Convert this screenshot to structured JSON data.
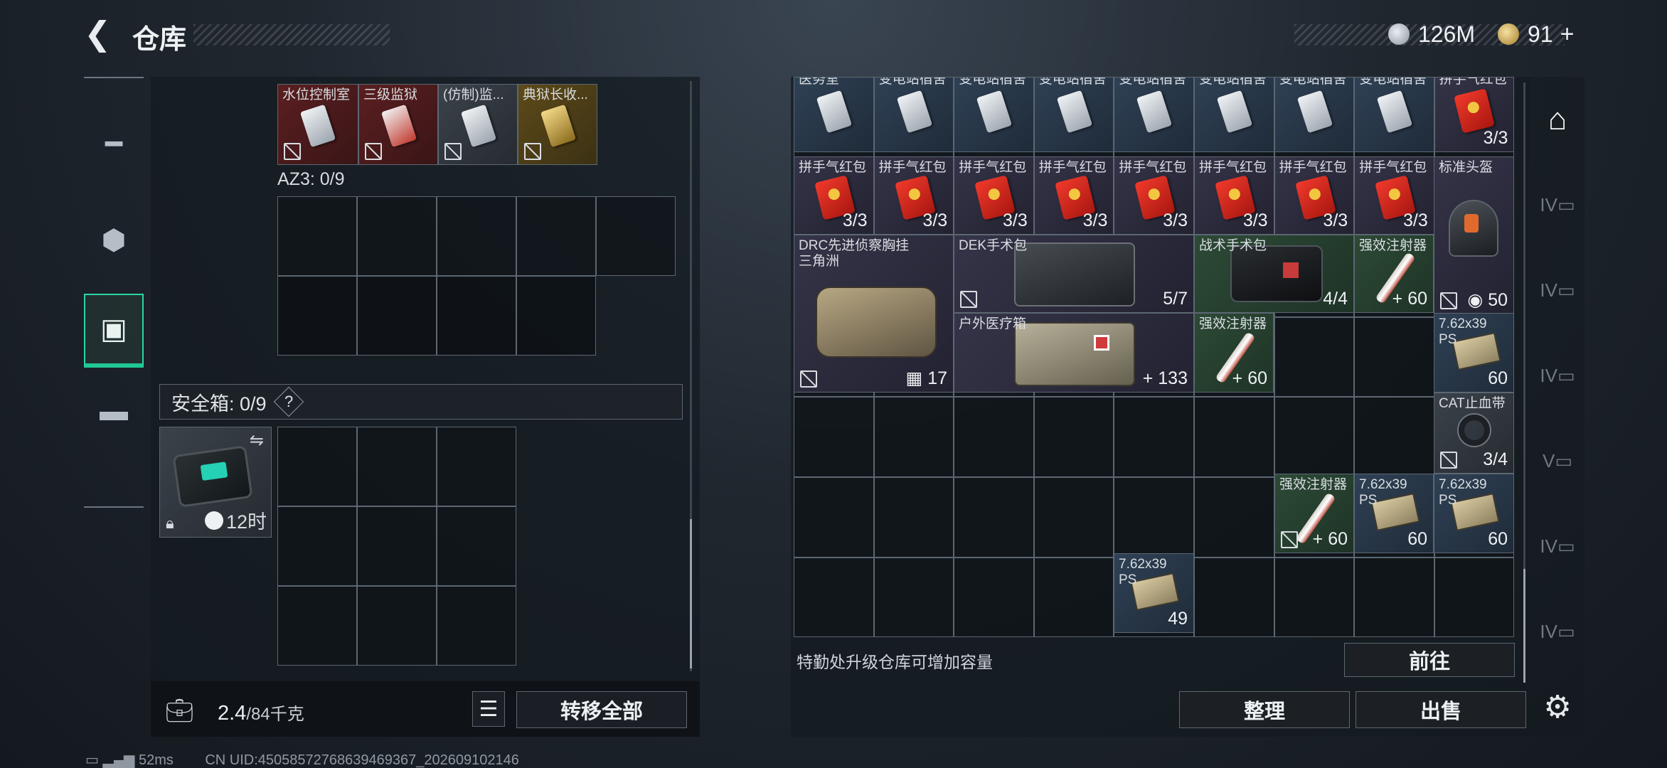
{
  "header": {
    "back_icon": "chevron-left-icon",
    "title": "仓库",
    "currency1": "126M",
    "currency2": "91"
  },
  "left": {
    "top_items": [
      {
        "name": "水位控制室",
        "icon": "keycard-icon"
      },
      {
        "name": "三级监狱",
        "icon": "keycard-icon"
      },
      {
        "name": "(仿制)监...",
        "icon": "keycard-icon"
      },
      {
        "name": "典狱长收...",
        "icon": "keycard-icon"
      }
    ],
    "az3_label": "AZ3: 0/9",
    "safebox_label": "安全箱: 0/9",
    "safebox_help": "?",
    "safebox_timer": "12时",
    "weight_value": "2.4",
    "weight_max": "/84千克",
    "transfer_all": "转移全部"
  },
  "right": {
    "row1": [
      "医务室",
      "变电站宿舍",
      "变电站宿舍",
      "变电站宿舍",
      "变电站宿舍",
      "变电站宿舍",
      "变电站宿舍",
      "变电站宿舍",
      "拼手气红包"
    ],
    "row1_last_count": "3/3",
    "redpack_name": "拼手气红包",
    "redpack_count": "3/3",
    "helmet_name": "标准头盔",
    "helmet_count": "50",
    "drc_name": "DRC先进侦察胸挂\n三角洲",
    "drc_count": "17",
    "dek_name": "DEK手术包",
    "dek_count": "5/7",
    "tactical_name": "战术手术包",
    "tactical_count": "4/4",
    "stim_name": "强效注射器",
    "stim_count": "60",
    "outdoor_name": "户外医疗箱",
    "outdoor_count": "133",
    "ammo_name": "7.62x39\nPS",
    "ammo_count60": "60",
    "ammo_count49": "49",
    "cat_name": "CAT止血带",
    "cat_count": "3/4",
    "upgrade_hint": "特勤处升级仓库可增加容量",
    "goto_btn": "前往",
    "sort_btn": "整理",
    "sell_btn": "出售"
  },
  "status": {
    "ping": "52ms",
    "uid": "CN UID:45058572768639469367_202609102146"
  },
  "colors": {
    "accent": "#2bd6a4",
    "red_item": "#5b1f20",
    "gold_item": "#5e4a19"
  }
}
